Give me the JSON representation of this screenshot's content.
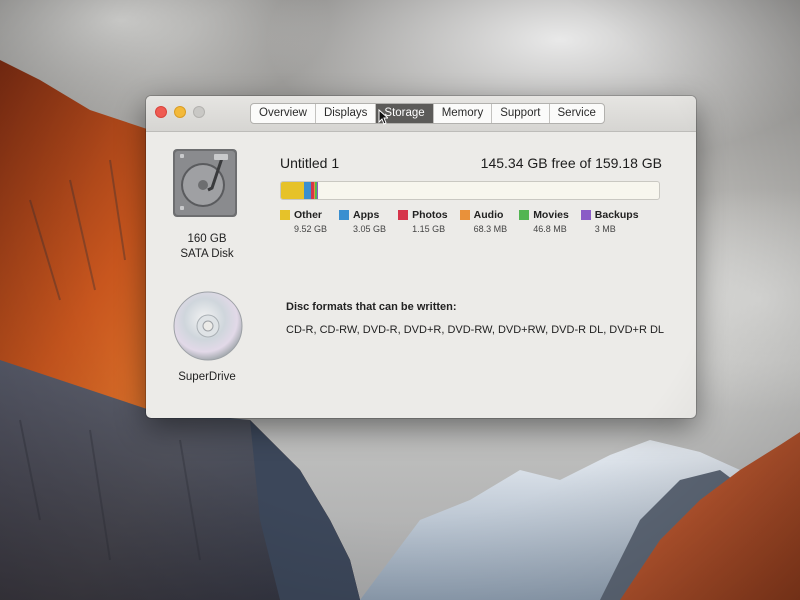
{
  "window": {
    "tabs": [
      {
        "label": "Overview",
        "active": false
      },
      {
        "label": "Displays",
        "active": false
      },
      {
        "label": "Storage",
        "active": true
      },
      {
        "label": "Memory",
        "active": false
      },
      {
        "label": "Support",
        "active": false
      },
      {
        "label": "Service",
        "active": false
      }
    ]
  },
  "disk": {
    "icon": "hard-drive-icon",
    "capacity_label": "160 GB",
    "type_label": "SATA Disk",
    "volume_name": "Untitled 1",
    "free_text": "145.34 GB free of 159.18 GB",
    "usage": [
      {
        "name": "Other",
        "size": "9.52 GB",
        "gb": 9.52,
        "color": "#e6c229"
      },
      {
        "name": "Apps",
        "size": "3.05 GB",
        "gb": 3.05,
        "color": "#3a8fd0"
      },
      {
        "name": "Photos",
        "size": "1.15 GB",
        "gb": 1.15,
        "color": "#d6344a"
      },
      {
        "name": "Audio",
        "size": "68.3 MB",
        "gb": 0.0683,
        "color": "#e9913a"
      },
      {
        "name": "Movies",
        "size": "46.8 MB",
        "gb": 0.0468,
        "color": "#53b552"
      },
      {
        "name": "Backups",
        "size": "3 MB",
        "gb": 0.003,
        "color": "#8a5cc6"
      }
    ],
    "total_gb": 159.18
  },
  "optical": {
    "icon": "optical-disc-icon",
    "label": "SuperDrive",
    "formats_title": "Disc formats that can be written:",
    "formats": "CD-R, CD-RW, DVD-R, DVD+R, DVD-RW, DVD+RW, DVD-R DL, DVD+R DL"
  }
}
